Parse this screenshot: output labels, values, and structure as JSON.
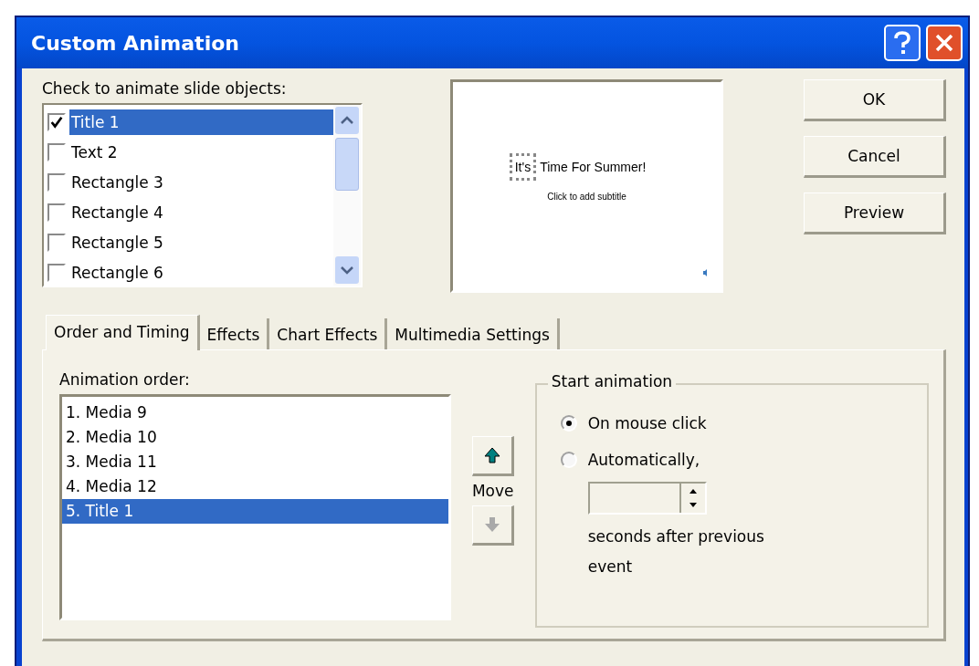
{
  "window": {
    "title": "Custom Animation"
  },
  "objects": {
    "label": "Check to animate slide objects:",
    "items": [
      {
        "name": "Title 1",
        "checked": true,
        "selected": true
      },
      {
        "name": "Text 2",
        "checked": false,
        "selected": false
      },
      {
        "name": "Rectangle 3",
        "checked": false,
        "selected": false
      },
      {
        "name": "Rectangle 4",
        "checked": false,
        "selected": false
      },
      {
        "name": "Rectangle 5",
        "checked": false,
        "selected": false
      },
      {
        "name": "Rectangle 6",
        "checked": false,
        "selected": false
      }
    ]
  },
  "preview": {
    "title_selected": "It's",
    "title_rest": "Time For Summer!",
    "subtitle": "Click to add subtitle"
  },
  "buttons": [
    "OK",
    "Cancel",
    "Preview"
  ],
  "tabs": [
    {
      "label": "Order and Timing",
      "selected": true
    },
    {
      "label": "Effects",
      "selected": false
    },
    {
      "label": "Chart Effects",
      "selected": false
    },
    {
      "label": "Multimedia Settings",
      "selected": false
    }
  ],
  "order": {
    "label": "Animation order:",
    "items": [
      {
        "text": "1. Media 9",
        "selected": false
      },
      {
        "text": "2. Media 10",
        "selected": false
      },
      {
        "text": "3. Media 11",
        "selected": false
      },
      {
        "text": "4. Media 12",
        "selected": false
      },
      {
        "text": "5. Title 1",
        "selected": true
      }
    ],
    "move_label": "Move",
    "move_up": {
      "disabled": false
    },
    "move_down": {
      "disabled": true
    }
  },
  "start": {
    "legend": "Start animation",
    "options": [
      {
        "label": "On mouse click",
        "selected": true
      },
      {
        "label": "Automatically,",
        "selected": false
      }
    ],
    "after": "seconds after previous event"
  }
}
